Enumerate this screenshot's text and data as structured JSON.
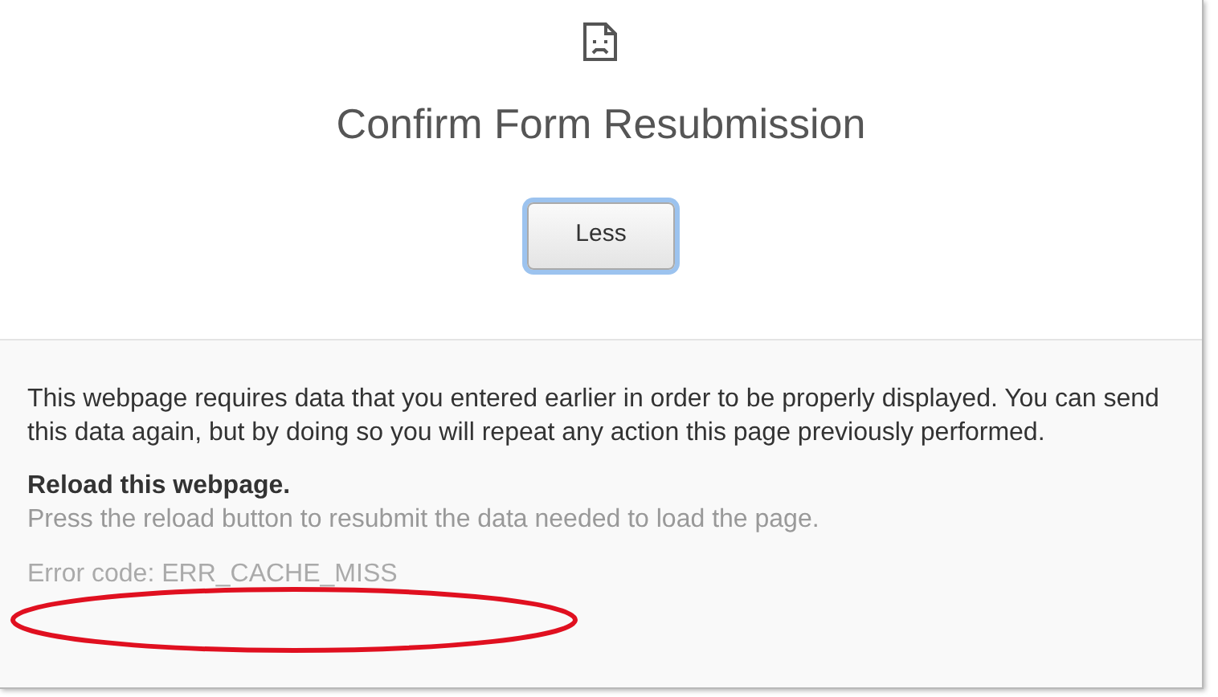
{
  "title": "Confirm Form Resubmission",
  "button": {
    "label": "Less"
  },
  "details": {
    "paragraph": "This webpage requires data that you entered earlier in order to be properly displayed. You can send this data again, but by doing so you will repeat any action this page previously performed.",
    "heading": "Reload this webpage.",
    "hint": "Press the reload button to resubmit the data needed to load the page.",
    "error_code": "Error code: ERR_CACHE_MISS"
  }
}
